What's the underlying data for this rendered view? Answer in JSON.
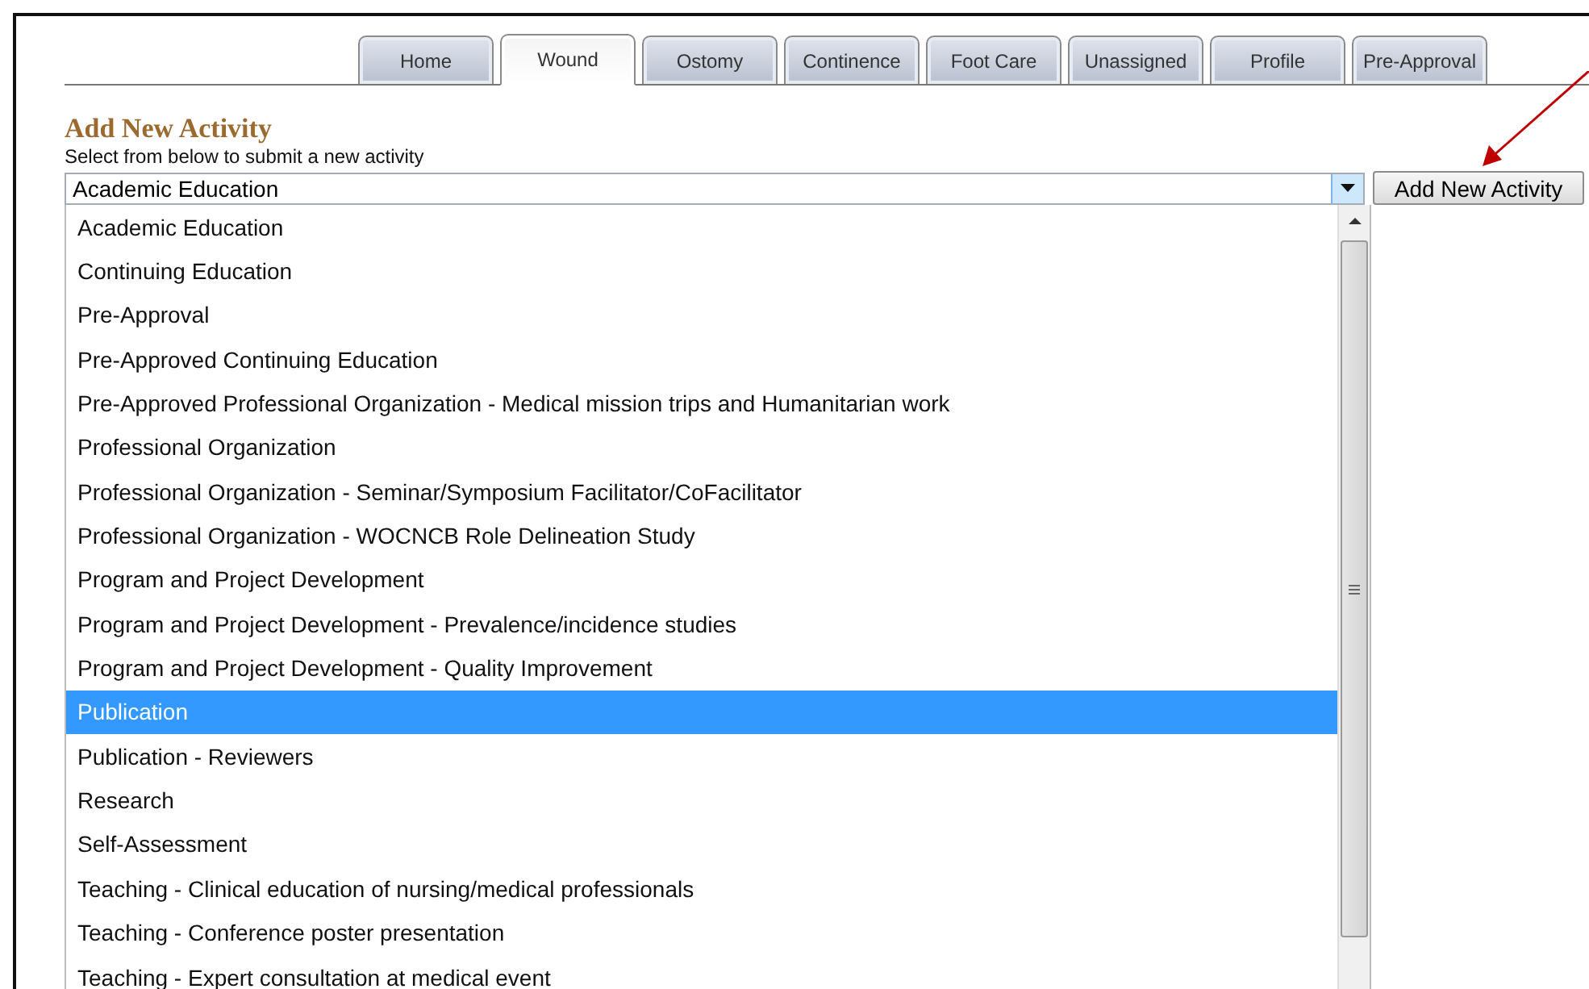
{
  "tabs": [
    {
      "label": "Home",
      "selected": false
    },
    {
      "label": "Wound",
      "selected": true
    },
    {
      "label": "Ostomy",
      "selected": false
    },
    {
      "label": "Continence",
      "selected": false
    },
    {
      "label": "Foot Care",
      "selected": false
    },
    {
      "label": "Unassigned",
      "selected": false
    },
    {
      "label": "Profile",
      "selected": false
    },
    {
      "label": "Pre-Approval",
      "selected": false
    }
  ],
  "heading": "Add New Activity",
  "instruction": "Select from below to submit a new activity",
  "activity_select": {
    "value": "Academic Education",
    "expanded": true
  },
  "add_button": "Add New Activity",
  "options": [
    {
      "label": "Academic Education",
      "selected": false
    },
    {
      "label": "Continuing Education",
      "selected": false
    },
    {
      "label": "Pre-Approval",
      "selected": false
    },
    {
      "label": "Pre-Approved Continuing Education",
      "selected": false
    },
    {
      "label": "Pre-Approved Professional Organization - Medical mission trips and Humanitarian work",
      "selected": false
    },
    {
      "label": "Professional Organization",
      "selected": false
    },
    {
      "label": "Professional Organization - Seminar/Symposium Facilitator/CoFacilitator",
      "selected": false
    },
    {
      "label": "Professional Organization - WOCNCB Role Delineation Study",
      "selected": false
    },
    {
      "label": "Program and Project Development",
      "selected": false
    },
    {
      "label": "Program and Project Development - Prevalence/incidence studies",
      "selected": false
    },
    {
      "label": "Program and Project Development - Quality Improvement",
      "selected": false
    },
    {
      "label": "Publication",
      "selected": true
    },
    {
      "label": "Publication - Reviewers",
      "selected": false
    },
    {
      "label": "Research",
      "selected": false
    },
    {
      "label": "Self-Assessment",
      "selected": false
    },
    {
      "label": "Teaching - Clinical education of nursing/medical professionals",
      "selected": false
    },
    {
      "label": "Teaching - Conference poster presentation",
      "selected": false
    },
    {
      "label": "Teaching - Expert consultation at medical event",
      "selected": false
    }
  ]
}
